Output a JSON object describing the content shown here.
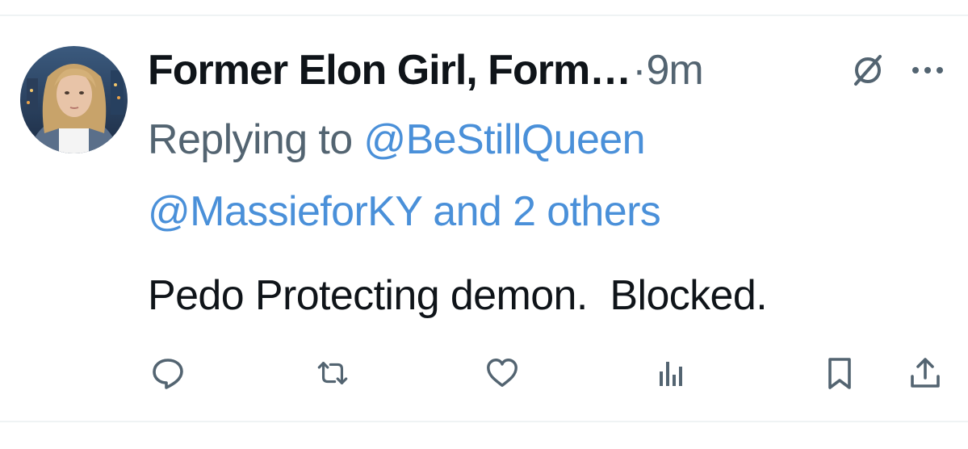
{
  "tweet": {
    "author": {
      "display_name": "Former Elon Girl, Form…",
      "avatar_icon": "profile-photo-avatar"
    },
    "separator": "·",
    "timestamp": "9m",
    "reply": {
      "prefix": "Replying to ",
      "handle": "@BeStillQueen",
      "second_handle": "@MassieforKY",
      "others": "and 2 others"
    },
    "text": "Pedo Protecting demon.  Blocked.",
    "actions": [
      {
        "name": "reply",
        "icon": "speech-bubble-icon"
      },
      {
        "name": "retweet",
        "icon": "repost-arrows-icon"
      },
      {
        "name": "like",
        "icon": "heart-icon"
      },
      {
        "name": "views",
        "icon": "bar-chart-icon"
      },
      {
        "name": "bookmark",
        "icon": "bookmark-icon"
      },
      {
        "name": "share",
        "icon": "share-upload-icon"
      }
    ],
    "colors": {
      "text": "#0f1419",
      "secondary": "#536471",
      "link": "#4a90d9",
      "divider": "#eff3f4"
    }
  }
}
